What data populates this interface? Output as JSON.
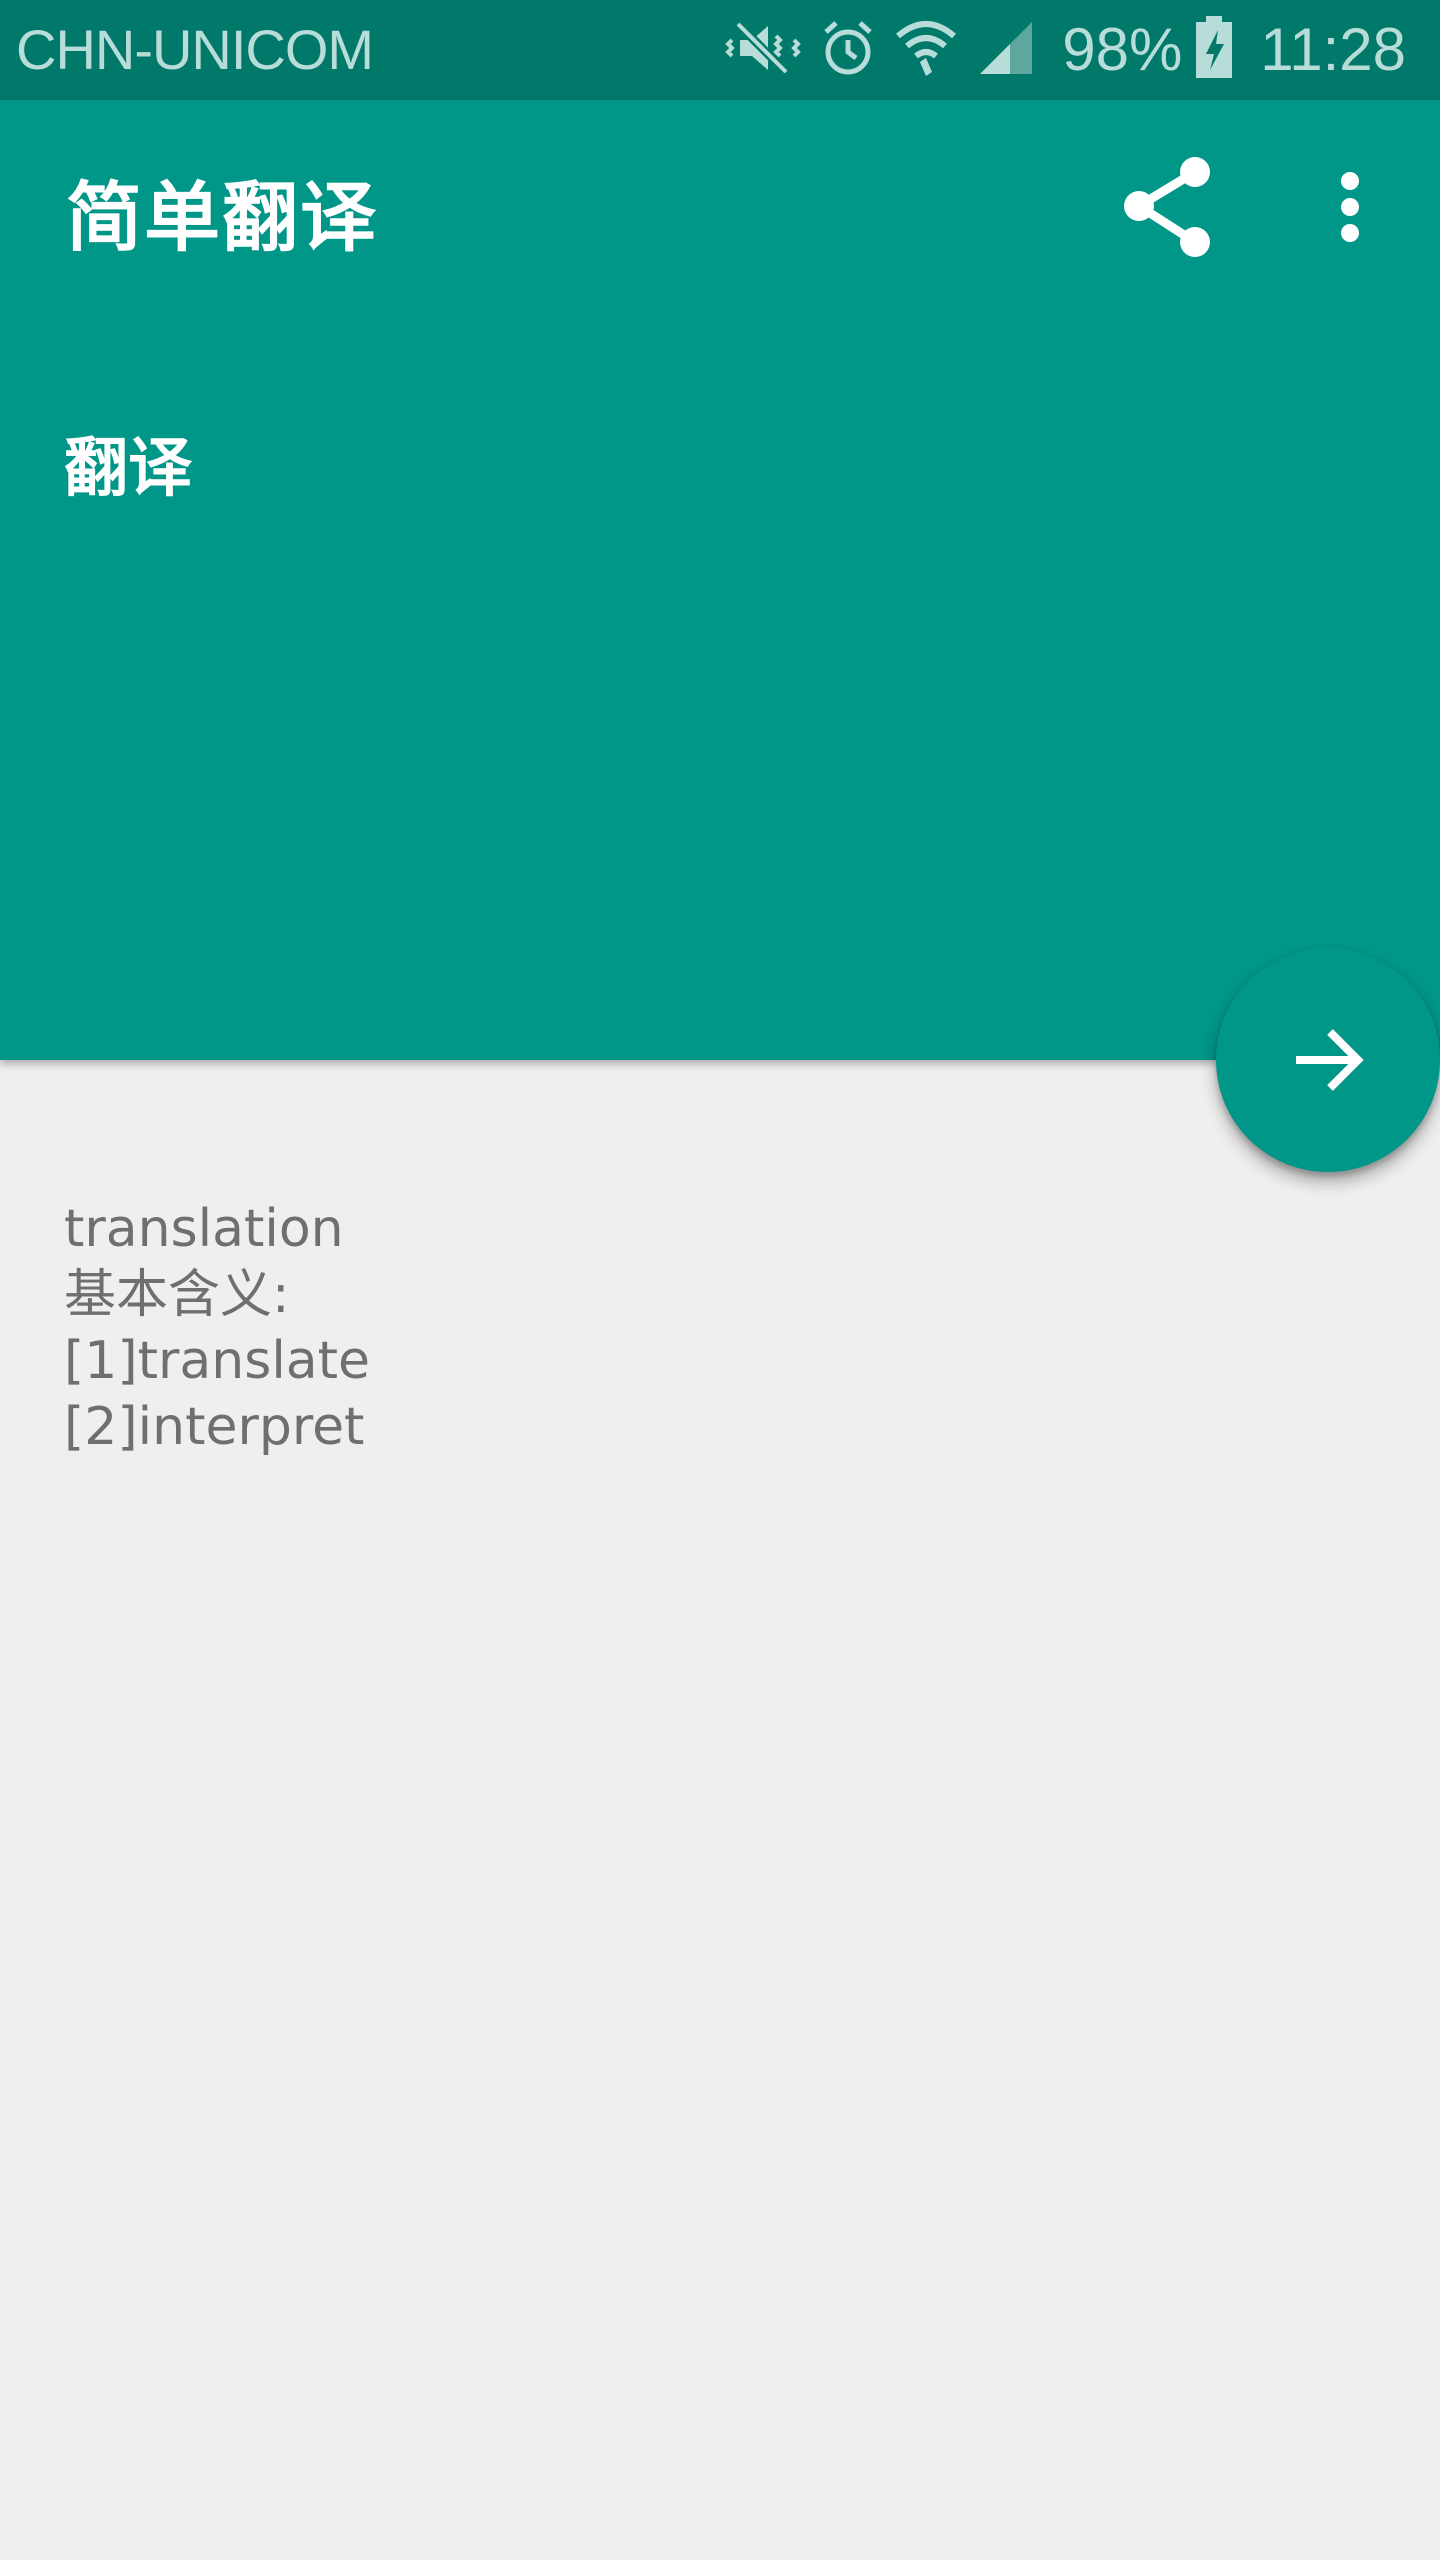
{
  "status_bar": {
    "carrier": "CHN-UNICOM",
    "battery": "98%",
    "time": "11:28",
    "icons": [
      "mute-vibrate-icon",
      "alarm-icon",
      "wifi-icon",
      "signal-icon",
      "battery-charging-icon"
    ]
  },
  "app_bar": {
    "title": "简单翻译",
    "share_icon": "share-icon",
    "more_icon": "more-vert-icon",
    "input_value": "翻译"
  },
  "fab": {
    "icon": "arrow-forward-icon"
  },
  "result": {
    "lines": [
      "translation",
      "基本含义:",
      "[1]translate",
      "[2]interpret"
    ]
  },
  "colors": {
    "primary": "#009688",
    "primary_dark": "#00796b",
    "background": "#efefef",
    "result_text": "#6f6f6f"
  }
}
